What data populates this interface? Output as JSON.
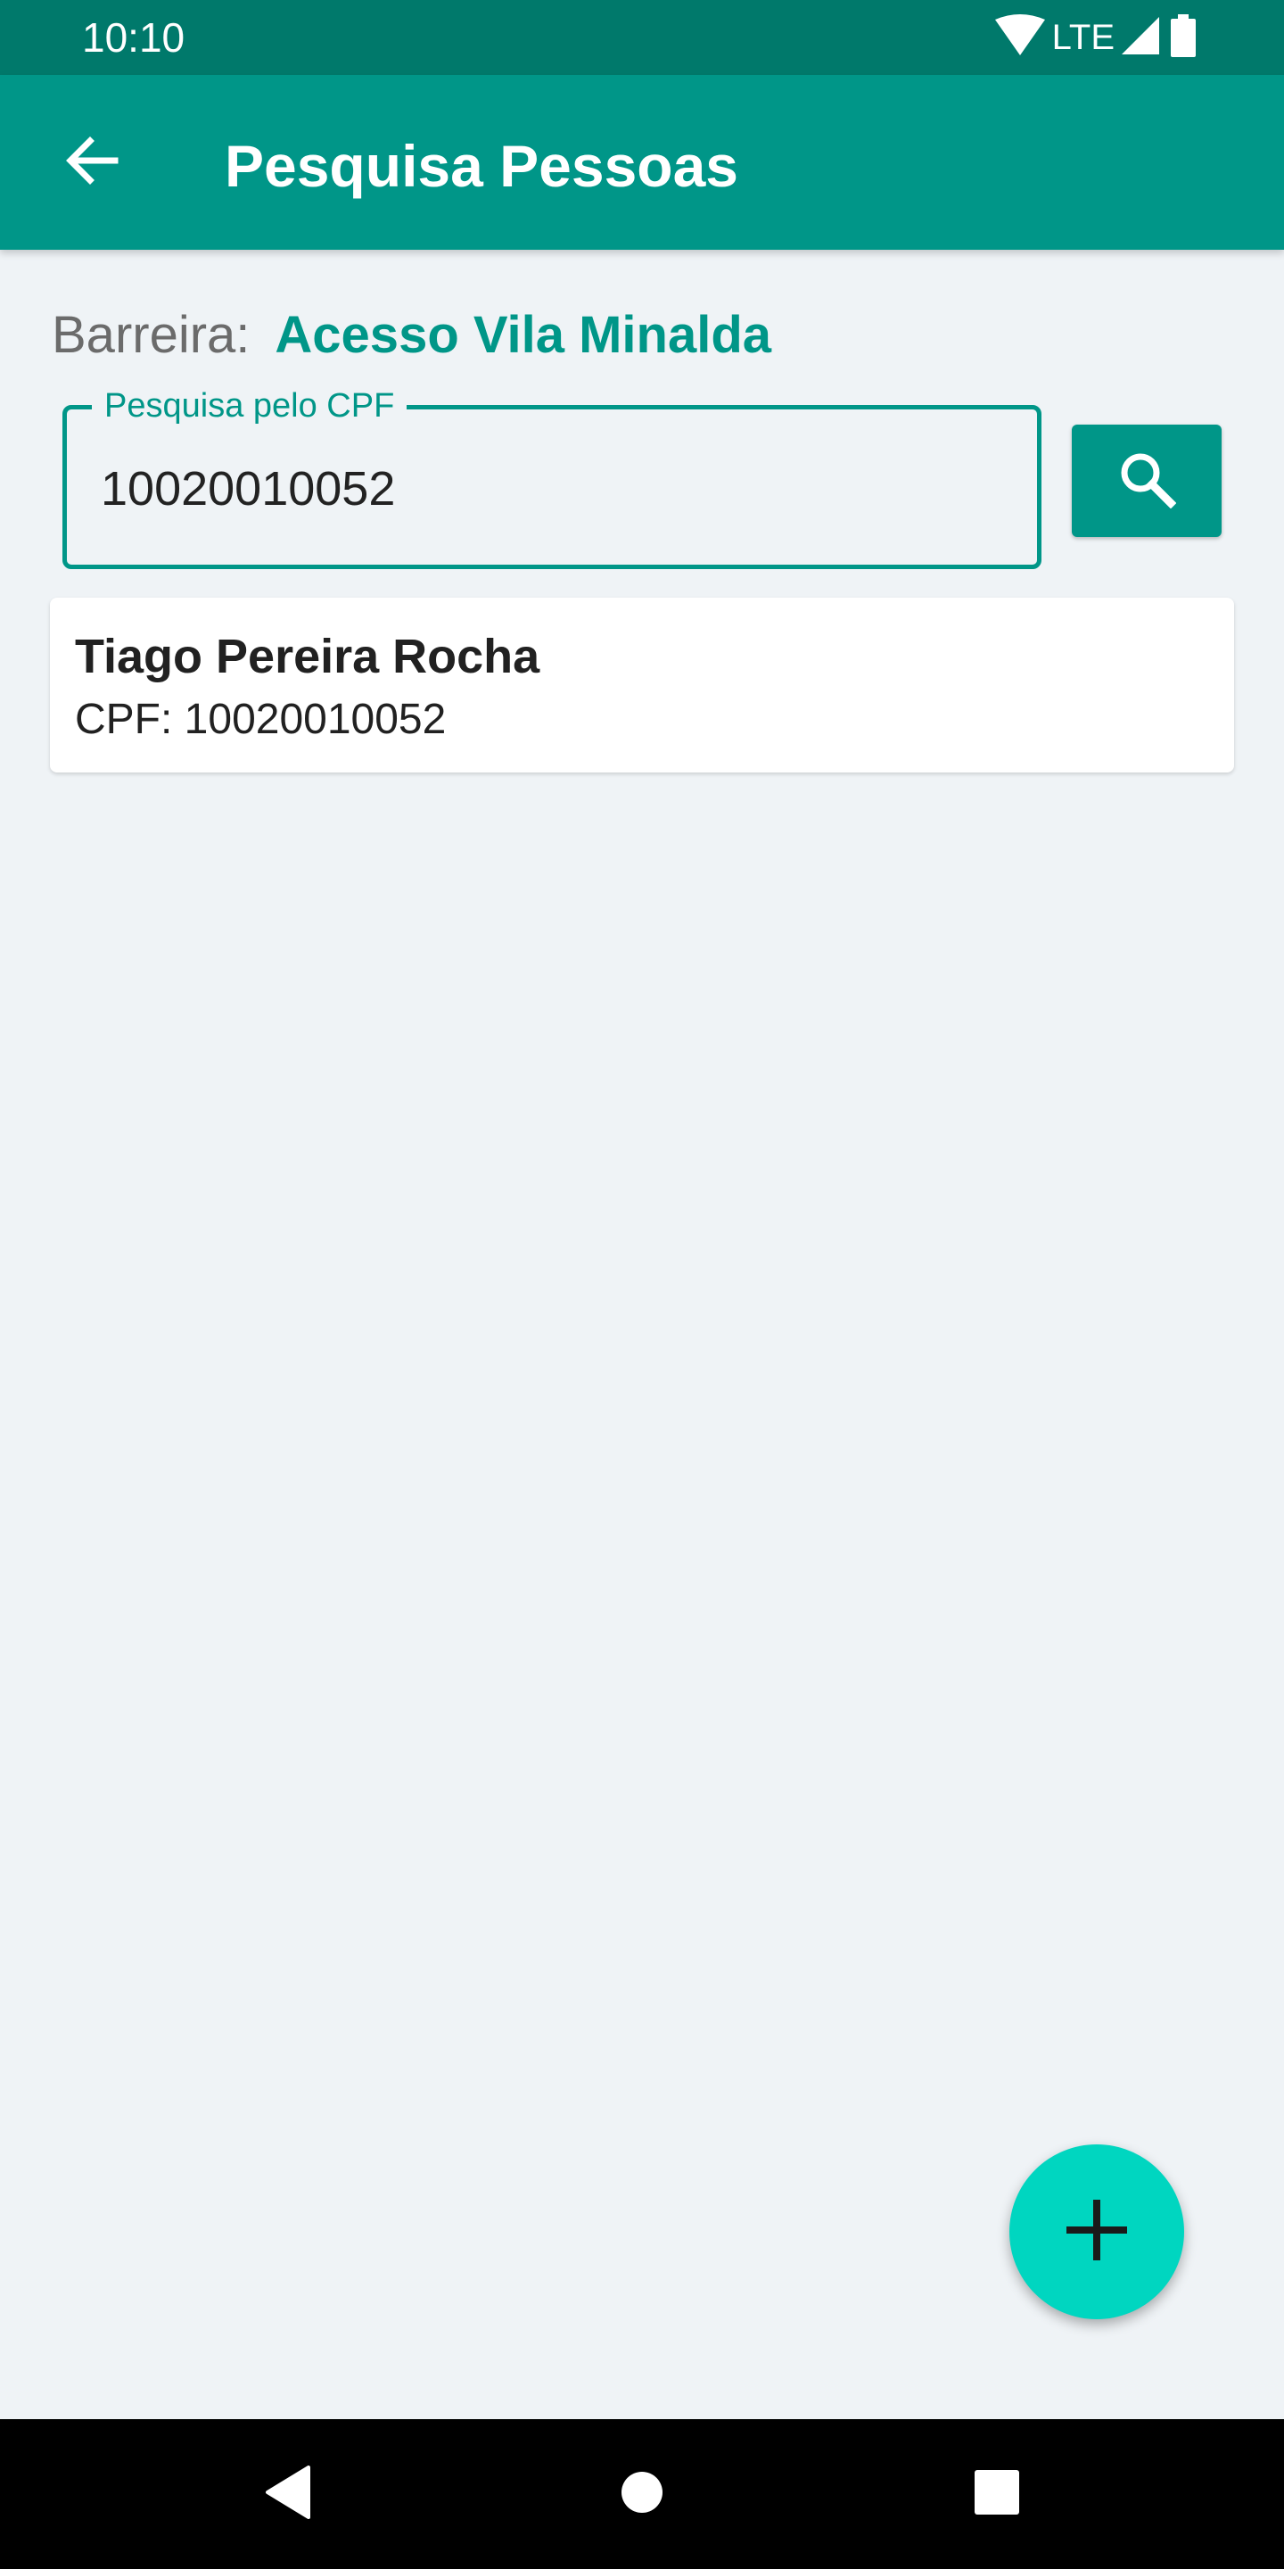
{
  "status_bar": {
    "time": "10:10",
    "network": "LTE",
    "wifi_icon": "wifi-icon",
    "signal_icon": "signal-icon",
    "battery_icon": "battery-icon"
  },
  "app_bar": {
    "title": "Pesquisa Pessoas",
    "back_icon": "arrow-back-icon"
  },
  "barrier": {
    "label": "Barreira:",
    "value": "Acesso Vila Minalda"
  },
  "search": {
    "label": "Pesquisa pelo CPF",
    "value": "10020010052",
    "button_icon": "search-icon"
  },
  "results": [
    {
      "name": "Tiago Pereira Rocha",
      "cpf_line": "CPF: 10020010052"
    }
  ],
  "fab": {
    "icon": "add-icon"
  },
  "nav": {
    "back_icon": "nav-back-icon",
    "home_icon": "nav-home-icon",
    "recents_icon": "nav-recents-icon"
  },
  "colors": {
    "primary": "#009688",
    "primary_dark": "#00796b",
    "accent": "#00d6c0",
    "background": "#eff3f6"
  }
}
